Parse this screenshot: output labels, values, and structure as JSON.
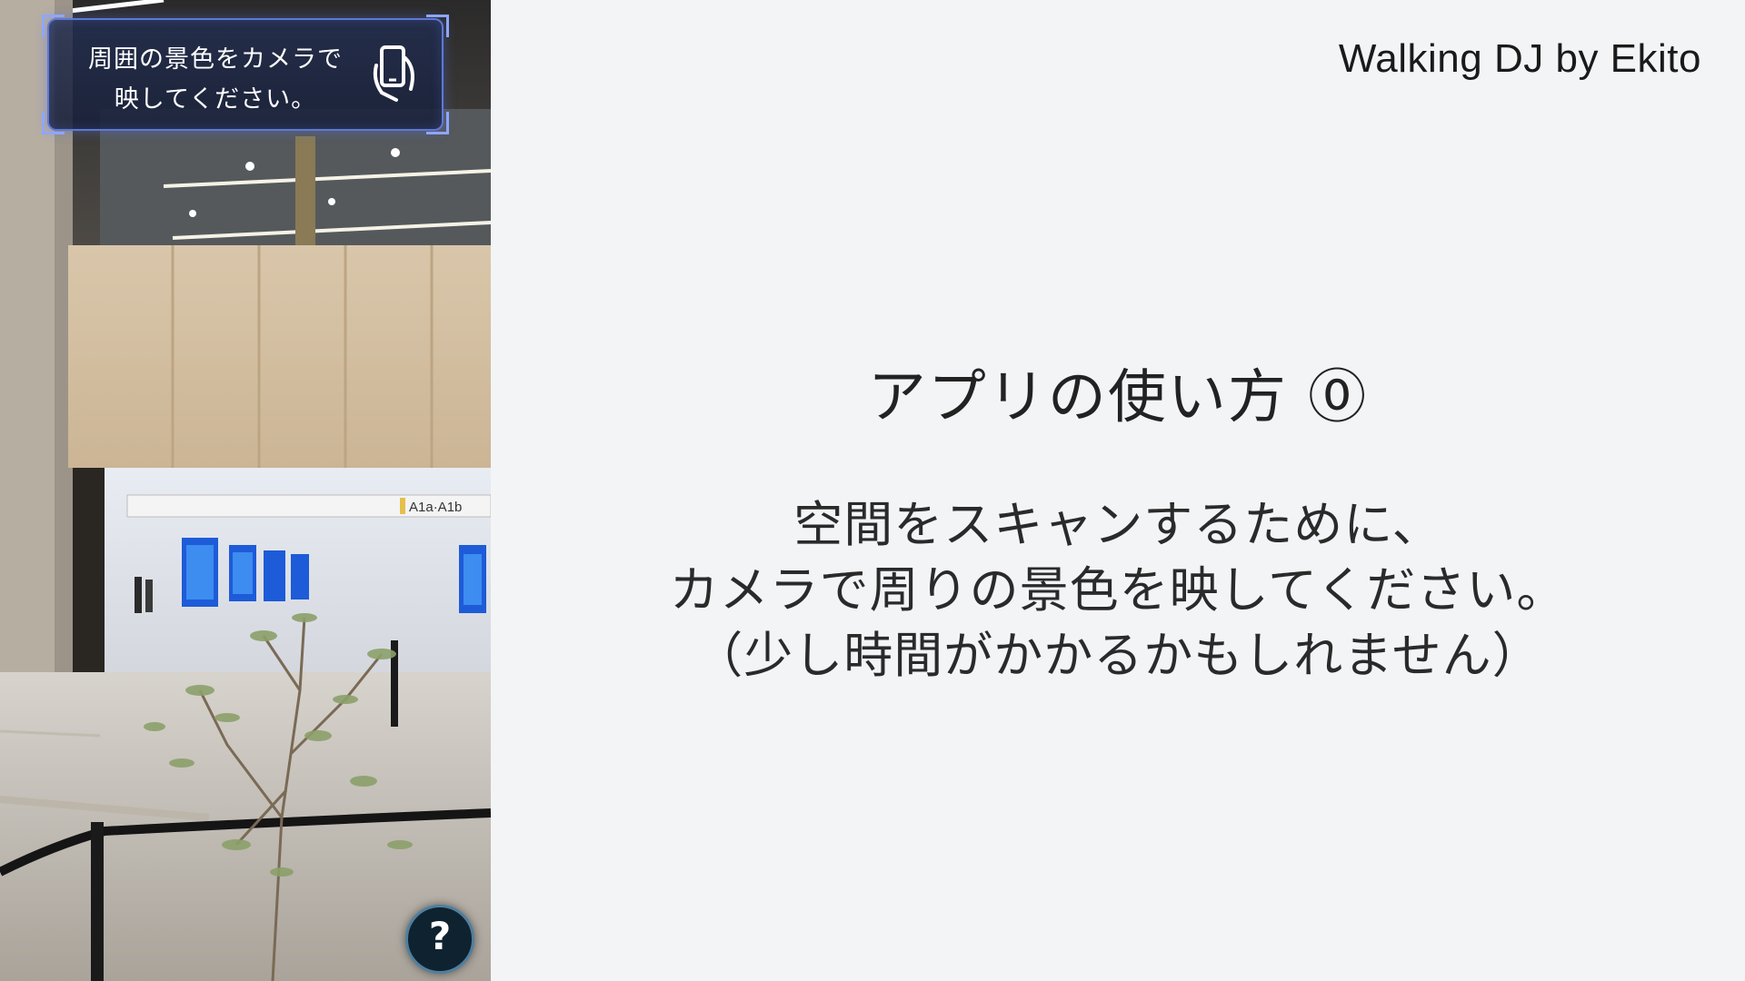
{
  "brand": "Walking DJ by Ekito",
  "slide": {
    "title": "アプリの使い方 ⓪",
    "body": [
      "空間をスキャンするために、",
      "カメラで周りの景色を映してください。",
      "（少し時間がかかるかもしれません）"
    ]
  },
  "phone": {
    "banner_lines": [
      "周囲の景色をカメラで",
      "映してください。"
    ],
    "banner_icon": "hand-phone-icon",
    "help_label": "?",
    "station_sign": "A1a·A1b"
  },
  "colors": {
    "background": "#f3f4f6",
    "banner_border": "#5f78d6",
    "banner_fill": "#222d4e",
    "help_fill": "#0f2230"
  }
}
